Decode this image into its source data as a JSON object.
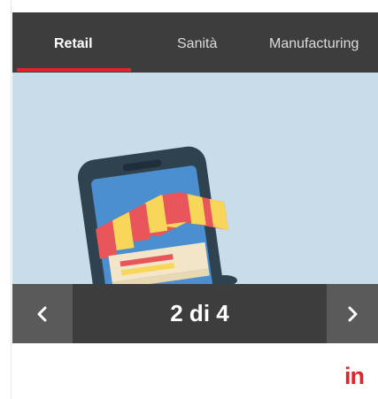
{
  "tabs": [
    {
      "label": "Retail",
      "active": true
    },
    {
      "label": "Sanità",
      "active": false
    },
    {
      "label": "Manufacturing",
      "active": false
    }
  ],
  "slider": {
    "counter": "2 di 4",
    "current": 2,
    "total": 4,
    "prev_icon": "chevron-left-icon",
    "next_icon": "chevron-right-icon"
  },
  "illustration": {
    "description_icon": "mobile-shop-icon"
  },
  "footer": {
    "linkedin_text": "in"
  },
  "colors": {
    "accent": "#e2242a",
    "dark_bar": "#3d3d3d",
    "button_bg": "#5a5a5a",
    "slide_bg": "#c9dcea"
  }
}
